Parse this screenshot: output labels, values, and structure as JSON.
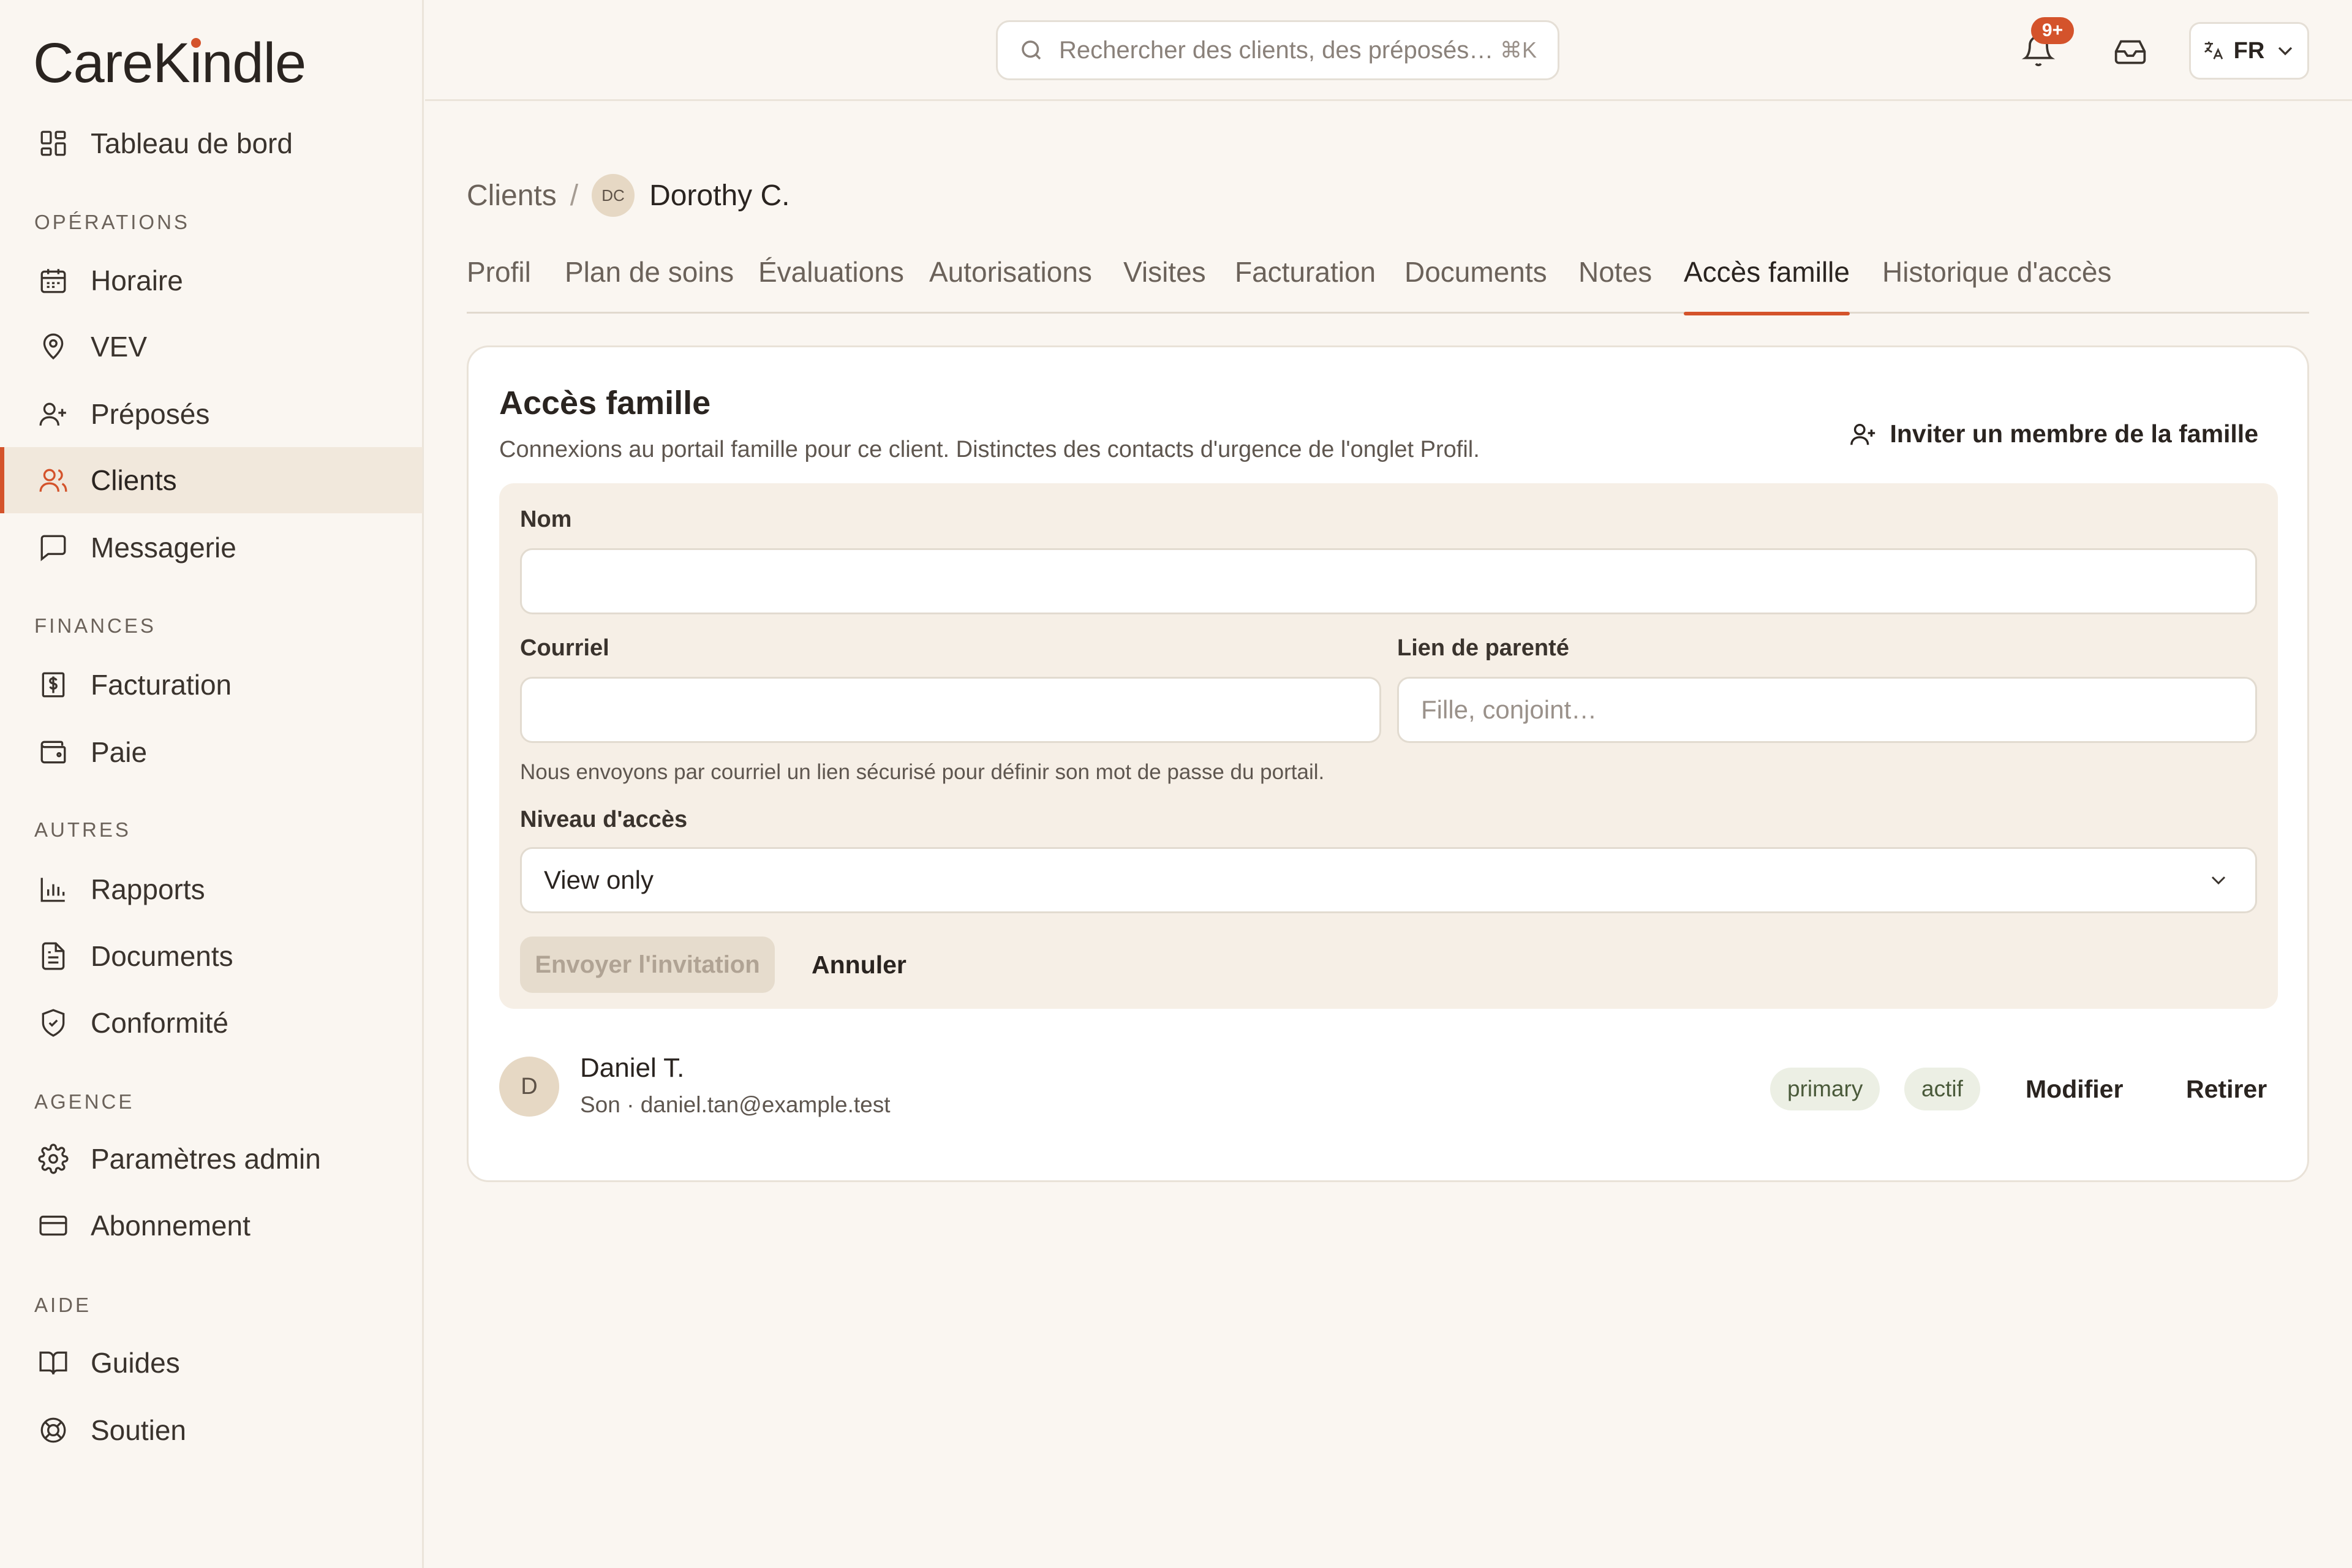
{
  "app": {
    "brand_pre": "CareK",
    "brand_i": "i",
    "brand_post": "ndle"
  },
  "sidebar": {
    "dashboard": "Tableau de bord",
    "sections": {
      "operations": "OPÉRATIONS",
      "finances": "FINANCES",
      "others": "AUTRES",
      "agency": "AGENCE",
      "help": "AIDE"
    },
    "items": {
      "schedule": "Horaire",
      "evv": "VEV",
      "caregivers": "Préposés",
      "clients": "Clients",
      "messaging": "Messagerie",
      "billing": "Facturation",
      "payroll": "Paie",
      "reports": "Rapports",
      "documents": "Documents",
      "compliance": "Conformité",
      "admin_settings": "Paramètres admin",
      "subscription": "Abonnement",
      "guides": "Guides",
      "support": "Soutien"
    },
    "active": "Clients"
  },
  "topbar": {
    "search_placeholder": "Rechercher des clients, des préposés…",
    "search_shortcut": "⌘K",
    "notification_count": "9+",
    "language": "FR"
  },
  "breadcrumb": {
    "parent": "Clients",
    "separator": "/",
    "client_initials": "DC",
    "client_name": "Dorothy C."
  },
  "tabs": [
    "Profil",
    "Plan de soins",
    "Évaluations",
    "Autorisations",
    "Visites",
    "Facturation",
    "Documents",
    "Notes",
    "Accès famille",
    "Historique d'accès"
  ],
  "active_tab": "Accès famille",
  "family_access": {
    "title": "Accès famille",
    "subtitle": "Connexions au portail famille pour ce client. Distinctes des contacts d'urgence de l'onglet Profil.",
    "invite_button": "Inviter un membre de la famille",
    "form": {
      "name_label": "Nom",
      "name_value": "",
      "email_label": "Courriel",
      "email_value": "",
      "relationship_label": "Lien de parenté",
      "relationship_placeholder": "Fille, conjoint…",
      "email_hint": "Nous envoyons par courriel un lien sécurisé pour définir son mot de passe du portail.",
      "access_level_label": "Niveau d'accès",
      "access_level_value": "View only",
      "send_button": "Envoyer l'invitation",
      "cancel_button": "Annuler"
    },
    "members": [
      {
        "initial": "D",
        "name": "Daniel T.",
        "meta": "Son · daniel.tan@example.test",
        "role_badge": "primary",
        "status_badge": "actif",
        "edit_button": "Modifier",
        "remove_button": "Retirer"
      }
    ]
  },
  "colors": {
    "accent": "#d4532b",
    "background": "#faf6f1",
    "active_nav_bg": "#f1e8dc",
    "form_bg": "#f6efe6",
    "badge_green_bg": "#ecefe4"
  }
}
